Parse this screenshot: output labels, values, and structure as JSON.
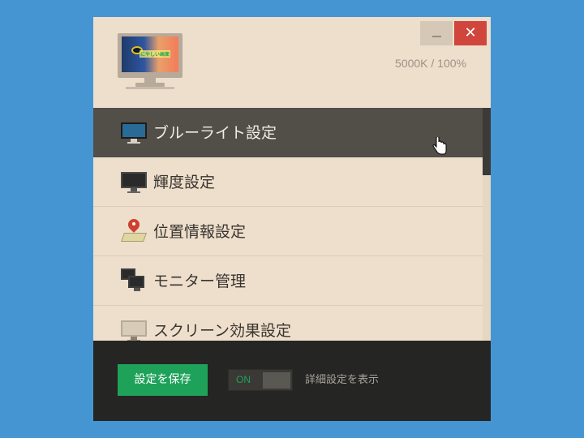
{
  "window": {
    "minimize_icon": "minimize-icon",
    "close_label": "✕"
  },
  "header": {
    "monitor_logo_text": "にやしい画面",
    "status": "5000K / 100%"
  },
  "menu": {
    "items": [
      {
        "label": "ブルーライト設定",
        "icon": "monitor-icon",
        "active": true
      },
      {
        "label": "輝度設定",
        "icon": "monitor-icon",
        "active": false
      },
      {
        "label": "位置情報設定",
        "icon": "map-pin-icon",
        "active": false
      },
      {
        "label": "モニター管理",
        "icon": "multi-monitor-icon",
        "active": false
      },
      {
        "label": "スクリーン効果設定",
        "icon": "monitor-icon",
        "active": false
      }
    ]
  },
  "footer": {
    "save_label": "設定を保存",
    "toggle_label": "ON",
    "advanced_label": "詳細設定を表示"
  },
  "colors": {
    "background": "#4595d3",
    "window": "#eedfcc",
    "active_item": "#524e48",
    "footer": "#252523",
    "save_button": "#1ea25a",
    "close_button": "#d0453c"
  }
}
